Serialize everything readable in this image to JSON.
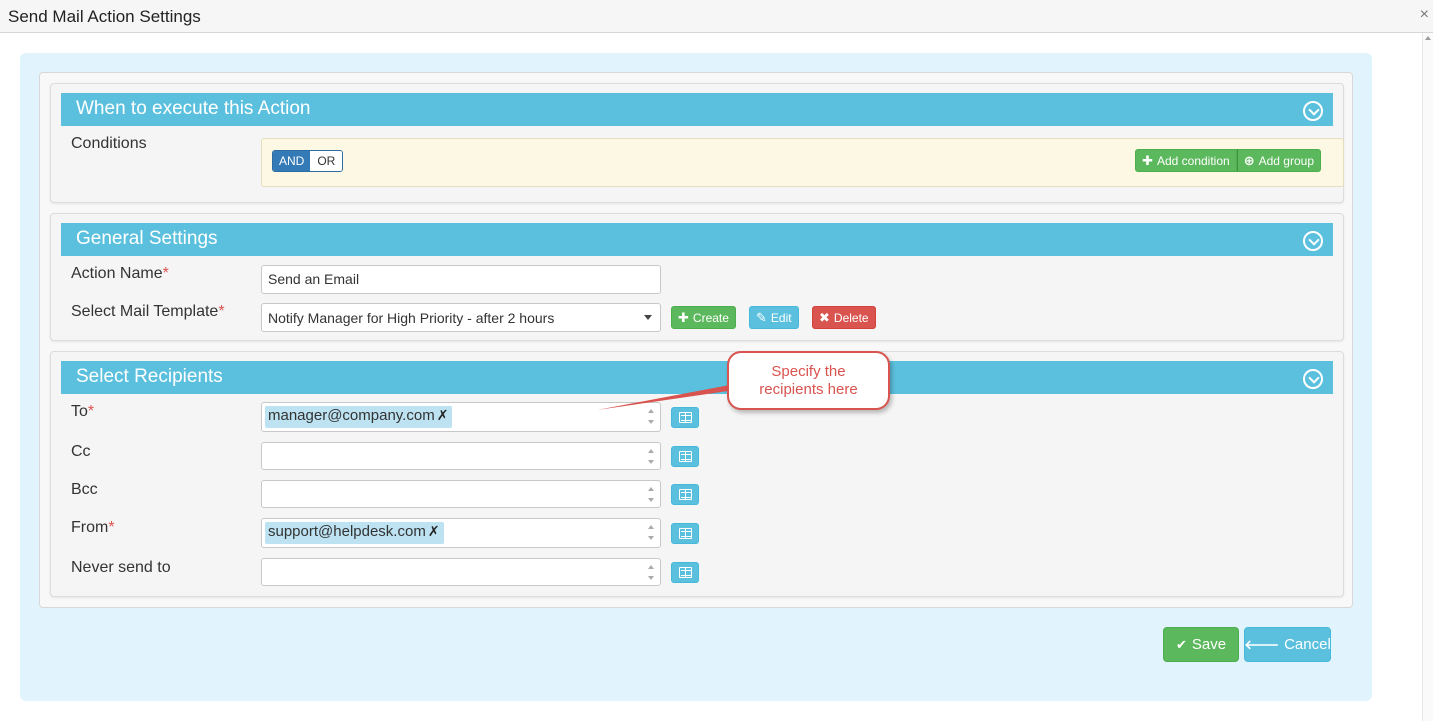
{
  "window": {
    "title": "Send Mail Action Settings",
    "close_glyph": "×"
  },
  "conditions_panel": {
    "title": "When to execute this Action",
    "conditions_label": "Conditions",
    "and_label": "AND",
    "or_label": "OR",
    "add_condition_label": "Add condition",
    "add_group_label": "Add group"
  },
  "general_panel": {
    "title": "General Settings",
    "action_name_label": "Action Name",
    "action_name_value": "Send an Email",
    "template_label": "Select Mail Template",
    "template_value": "Notify Manager for High Priority - after 2 hours",
    "create_label": "Create",
    "edit_label": "Edit",
    "delete_label": "Delete",
    "required_mark": "*"
  },
  "recipients_panel": {
    "title": "Select Recipients",
    "to_label": "To",
    "to_value": "manager@company.com",
    "cc_label": "Cc",
    "bcc_label": "Bcc",
    "from_label": "From",
    "from_value": "support@helpdesk.com",
    "never_label": "Never send to",
    "tag_remove_glyph": "✗",
    "required_mark": "*"
  },
  "callout": {
    "line1": "Specify the",
    "line2": "recipients here"
  },
  "footer": {
    "save_label": "Save",
    "cancel_label": "Cancel"
  },
  "colors": {
    "panel_header": "#5bc0de",
    "success": "#5cb85c",
    "danger": "#d9534f",
    "primary": "#337ab7",
    "dialog_bg": "#e1f3fc"
  },
  "icons": [
    "chevron-circle-down-icon",
    "plus-icon",
    "plus-circle-icon",
    "edit-icon",
    "times-icon",
    "address-book-icon",
    "check-icon",
    "arrow-left-icon"
  ]
}
